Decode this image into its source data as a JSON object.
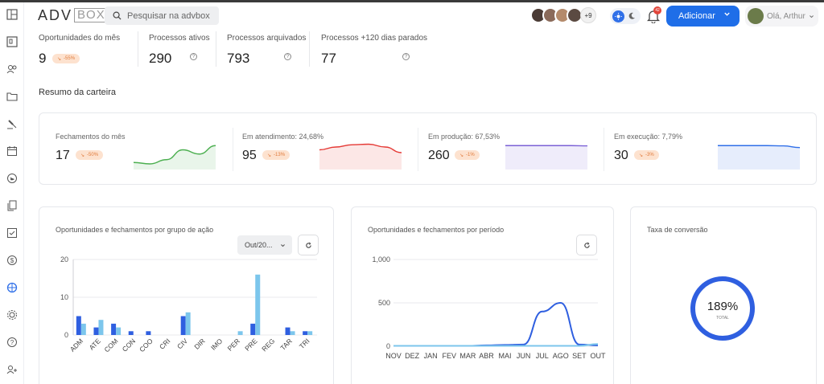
{
  "header": {
    "logo_adv": "ADV",
    "logo_box": "BOX",
    "search_placeholder": "Pesquisar na advbox",
    "avatars_more": "+9",
    "notification_count": "42",
    "add_button_label": "Adicionar",
    "user_greeting": "Olá, Arthur"
  },
  "sidebar": {
    "items": [
      {
        "icon": "dashboard-icon"
      },
      {
        "icon": "kanban-icon"
      },
      {
        "icon": "contacts-icon"
      },
      {
        "icon": "folder-icon"
      },
      {
        "icon": "gavel-icon"
      },
      {
        "icon": "calendar-icon"
      },
      {
        "icon": "globe-icon"
      },
      {
        "icon": "documents-icon"
      },
      {
        "icon": "tasks-icon"
      },
      {
        "icon": "finance-icon"
      },
      {
        "icon": "target-icon"
      },
      {
        "icon": "settings-icon"
      },
      {
        "icon": "help-icon"
      },
      {
        "icon": "add-user-icon"
      }
    ]
  },
  "stats": [
    {
      "label": "Oportunidades do mês",
      "value": "9",
      "badge": "-55%"
    },
    {
      "label": "Processos ativos",
      "value": "290"
    },
    {
      "label": "Processos arquivados",
      "value": "793"
    },
    {
      "label": "Processos +120 dias parados",
      "value": "77"
    }
  ],
  "section_title": "Resumo da carteira",
  "kpis": [
    {
      "label": "Fechamentos do mês",
      "value": "17",
      "badge": "-50%",
      "color": "#4caf50",
      "trend": [
        0.25,
        0.2,
        0.35,
        0.7,
        0.55,
        0.85
      ]
    },
    {
      "label": "Em atendimento: 24,68%",
      "value": "95",
      "badge": "-13%",
      "color": "#e53935",
      "trend": [
        0.7,
        0.8,
        0.88,
        0.9,
        0.8,
        0.6
      ]
    },
    {
      "label": "Em produção: 67,53%",
      "value": "260",
      "badge": "-1%",
      "color": "#7b61d6",
      "trend": [
        0.85,
        0.85,
        0.85,
        0.85,
        0.85,
        0.84
      ]
    },
    {
      "label": "Em execução: 7,79%",
      "value": "30",
      "badge": "-3%",
      "color": "#2f6fe8",
      "trend": [
        0.85,
        0.85,
        0.85,
        0.85,
        0.84,
        0.78
      ]
    }
  ],
  "charts": {
    "bar_title": "Oportunidades e fechamentos por grupo de ação",
    "bar_select": "Out/20...",
    "line_title": "Oportunidades e fechamentos por período",
    "donut_title": "Taxa de conversão",
    "donut_value": "189%",
    "donut_label": "TOTAL",
    "donut_fraction": 1.0,
    "colors": {
      "dark": "#2f5fe0",
      "light": "#7cc6ec"
    }
  },
  "chart_data": [
    {
      "type": "bar",
      "title": "Oportunidades e fechamentos por grupo de ação",
      "categories": [
        "ADM",
        "ATE",
        "COM",
        "CON",
        "COO",
        "CRI",
        "CIV",
        "DIR",
        "IMO",
        "PER",
        "PRE",
        "REG",
        "TAR",
        "TRI"
      ],
      "series": [
        {
          "values": [
            5,
            2,
            3,
            1,
            1,
            0,
            5,
            0,
            0,
            0,
            3,
            0,
            2,
            1
          ]
        },
        {
          "values": [
            3,
            4,
            2,
            0,
            0,
            0,
            6,
            0,
            0,
            1,
            16,
            0,
            1,
            1
          ]
        }
      ],
      "ylim": [
        0,
        20
      ],
      "yticks": [
        0,
        10,
        20
      ]
    },
    {
      "type": "line",
      "title": "Oportunidades e fechamentos por período",
      "categories": [
        "NOV",
        "DEZ",
        "JAN",
        "FEV",
        "MAR",
        "ABR",
        "MAI",
        "JUN",
        "JUL",
        "AGO",
        "SET",
        "OUT"
      ],
      "series": [
        {
          "values": [
            5,
            5,
            5,
            5,
            5,
            10,
            15,
            20,
            400,
            500,
            20,
            10
          ]
        },
        {
          "values": [
            5,
            5,
            5,
            5,
            5,
            5,
            5,
            5,
            5,
            5,
            5,
            25
          ]
        }
      ],
      "ylim": [
        0,
        1000
      ],
      "yticks": [
        "0",
        "500",
        "1,000"
      ]
    }
  ]
}
